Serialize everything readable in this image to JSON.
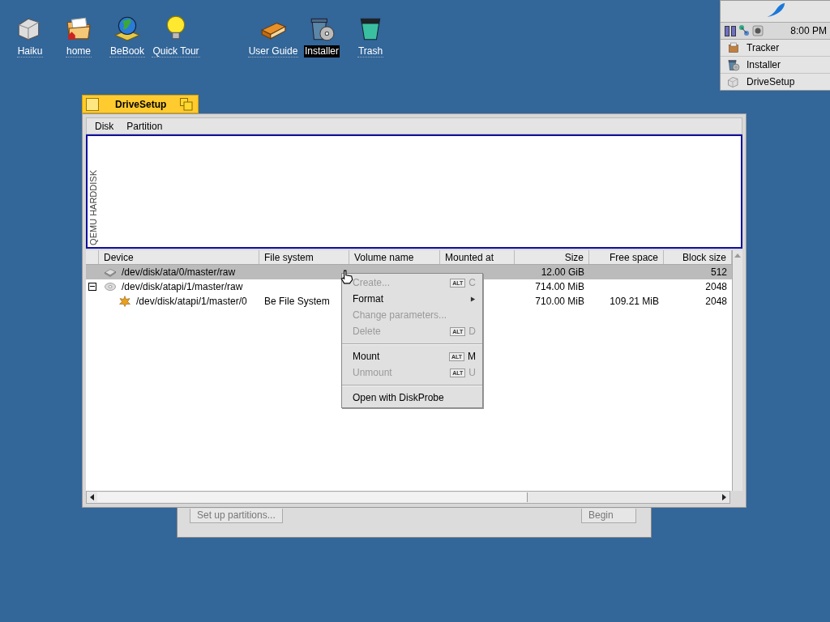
{
  "desktop_icons": [
    {
      "label": "Haiku",
      "selected": false
    },
    {
      "label": "home",
      "selected": false
    },
    {
      "label": "BeBook",
      "selected": false
    },
    {
      "label": "Quick Tour",
      "selected": false
    },
    {
      "label": "User Guide",
      "selected": false
    },
    {
      "label": "Installer",
      "selected": true
    },
    {
      "label": "Trash",
      "selected": false
    }
  ],
  "deskbar": {
    "clock": "8:00 PM",
    "items": [
      {
        "label": "Tracker"
      },
      {
        "label": "Installer"
      },
      {
        "label": "DriveSetup"
      }
    ]
  },
  "background_window": {
    "buttons": [
      {
        "label": "Set up partitions..."
      },
      {
        "label": "Begin"
      }
    ]
  },
  "window": {
    "title": "DriveSetup",
    "menu_bar": [
      "Disk",
      "Partition"
    ],
    "disk_map": {
      "label": "QEMU HARDDISK"
    },
    "table": {
      "columns": [
        "Device",
        "File system",
        "Volume name",
        "Mounted at",
        "Size",
        "Free space",
        "Block size"
      ],
      "rows": [
        {
          "device": "/dev/disk/ata/0/master/raw",
          "size": "12.00 GiB",
          "block_size": "512",
          "selected": true
        },
        {
          "device": "/dev/disk/atapi/1/master/raw",
          "size": "714.00 MiB",
          "block_size": "2048",
          "selected": false,
          "expanded": true,
          "children": [
            {
              "device": "/dev/disk/atapi/1/master/0",
              "file_system": "Be File System",
              "size": "710.00 MiB",
              "free_space": "109.21 MiB",
              "block_size": "2048",
              "selected": false
            }
          ]
        }
      ]
    }
  },
  "context_menu": [
    {
      "kind": "item",
      "label": "Create...",
      "disabled": true,
      "modifier": "ALT",
      "key": "C"
    },
    {
      "kind": "submenu",
      "label": "Format",
      "disabled": false
    },
    {
      "kind": "item",
      "label": "Change parameters...",
      "disabled": true
    },
    {
      "kind": "item",
      "label": "Delete",
      "disabled": true,
      "modifier": "ALT",
      "key": "D"
    },
    {
      "kind": "separator"
    },
    {
      "kind": "item",
      "label": "Mount",
      "disabled": false,
      "modifier": "ALT",
      "key": "M"
    },
    {
      "kind": "item",
      "label": "Unmount",
      "disabled": true,
      "modifier": "ALT",
      "key": "U"
    },
    {
      "kind": "separator"
    },
    {
      "kind": "item",
      "label": "Open with DiskProbe",
      "disabled": false
    }
  ]
}
